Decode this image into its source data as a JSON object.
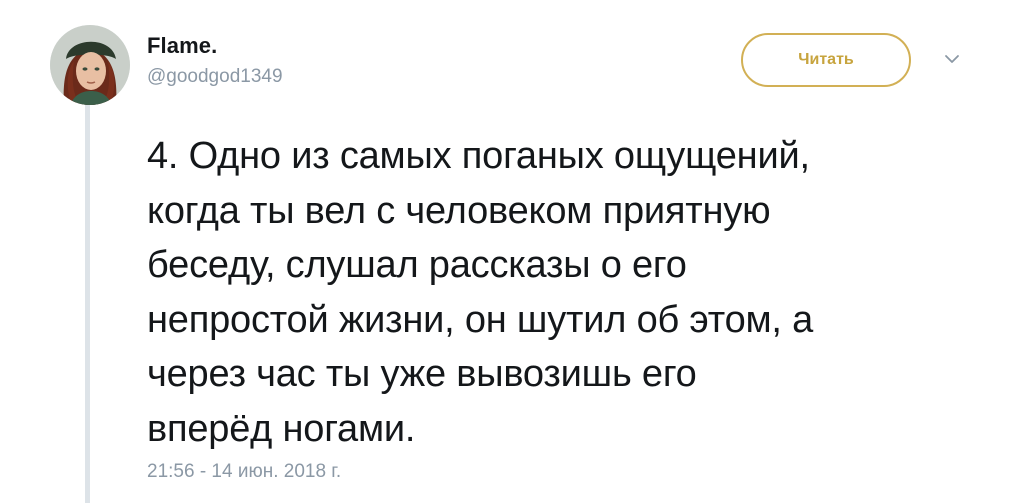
{
  "author": {
    "name": "Flame.",
    "handle": "@goodgod1349",
    "avatar_icon": "user-avatar-portrait"
  },
  "actions": {
    "follow_label": "Читать",
    "more_icon": "chevron-down-icon"
  },
  "tweet": {
    "text": "4. Одно из самых поганых ощущений,\nкогда ты вел с человеком приятную\nбеседу, слушал рассказы о его\nнепростой жизни, он шутил об этом, а\nчерез час ты уже вывозишь его\nвперёд ногами.",
    "timestamp": "21:56 - 14 июн. 2018 г."
  },
  "colors": {
    "accent": "#c7a43e",
    "text": "#14171a",
    "muted": "#8b98a5",
    "thread_line": "#dde3e8"
  }
}
